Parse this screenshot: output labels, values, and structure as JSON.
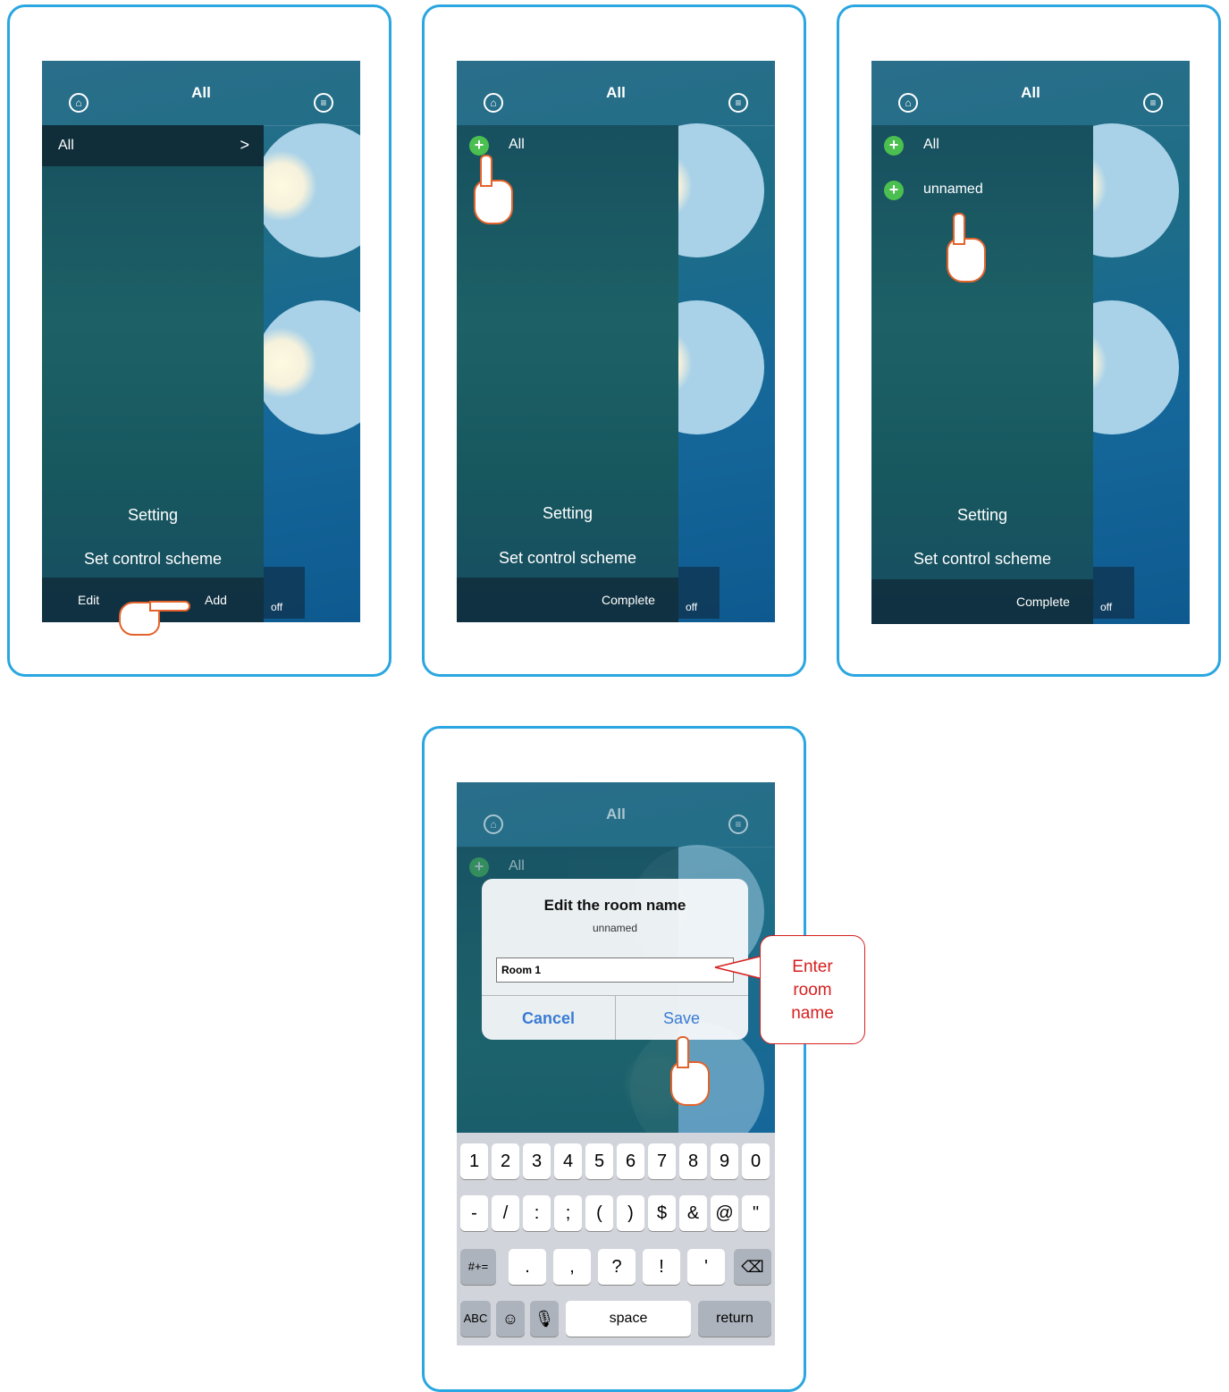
{
  "header_title": "All",
  "panels": {
    "p1": {
      "drawer_selected": "All",
      "chevron": ">",
      "setting": "Setting",
      "scheme": "Set control scheme",
      "edit": "Edit",
      "add": "Add",
      "off": "off"
    },
    "p2": {
      "item_all": "All",
      "setting": "Setting",
      "scheme": "Set control scheme",
      "complete": "Complete",
      "off": "off"
    },
    "p3": {
      "item_all": "All",
      "item_unnamed": "unnamed",
      "setting": "Setting",
      "scheme": "Set control scheme",
      "complete": "Complete",
      "off": "off"
    },
    "p4": {
      "item_all": "All",
      "dialog_title": "Edit the room name",
      "dialog_subtitle": "unnamed",
      "input_value": "Room 1",
      "cancel": "Cancel",
      "save": "Save",
      "keys_row1": [
        "1",
        "2",
        "3",
        "4",
        "5",
        "6",
        "7",
        "8",
        "9",
        "0"
      ],
      "keys_row2": [
        "-",
        "/",
        ":",
        ";",
        "(",
        ")",
        "$",
        "&",
        "@",
        "\""
      ],
      "keys_row3": [
        ".",
        ",",
        "?",
        "!",
        "'"
      ],
      "key_symbols": "#+=",
      "key_abc": "ABC",
      "key_space": "space",
      "key_return": "return",
      "callout_line1": "Enter",
      "callout_line2": "room",
      "callout_line3": "name"
    }
  },
  "colors": {
    "panel_border": "#2aa6e0",
    "hand_outline": "#e2632c",
    "callout": "#d62020",
    "plus_green": "#4bbf4f",
    "dialog_button": "#3a7bd5"
  }
}
